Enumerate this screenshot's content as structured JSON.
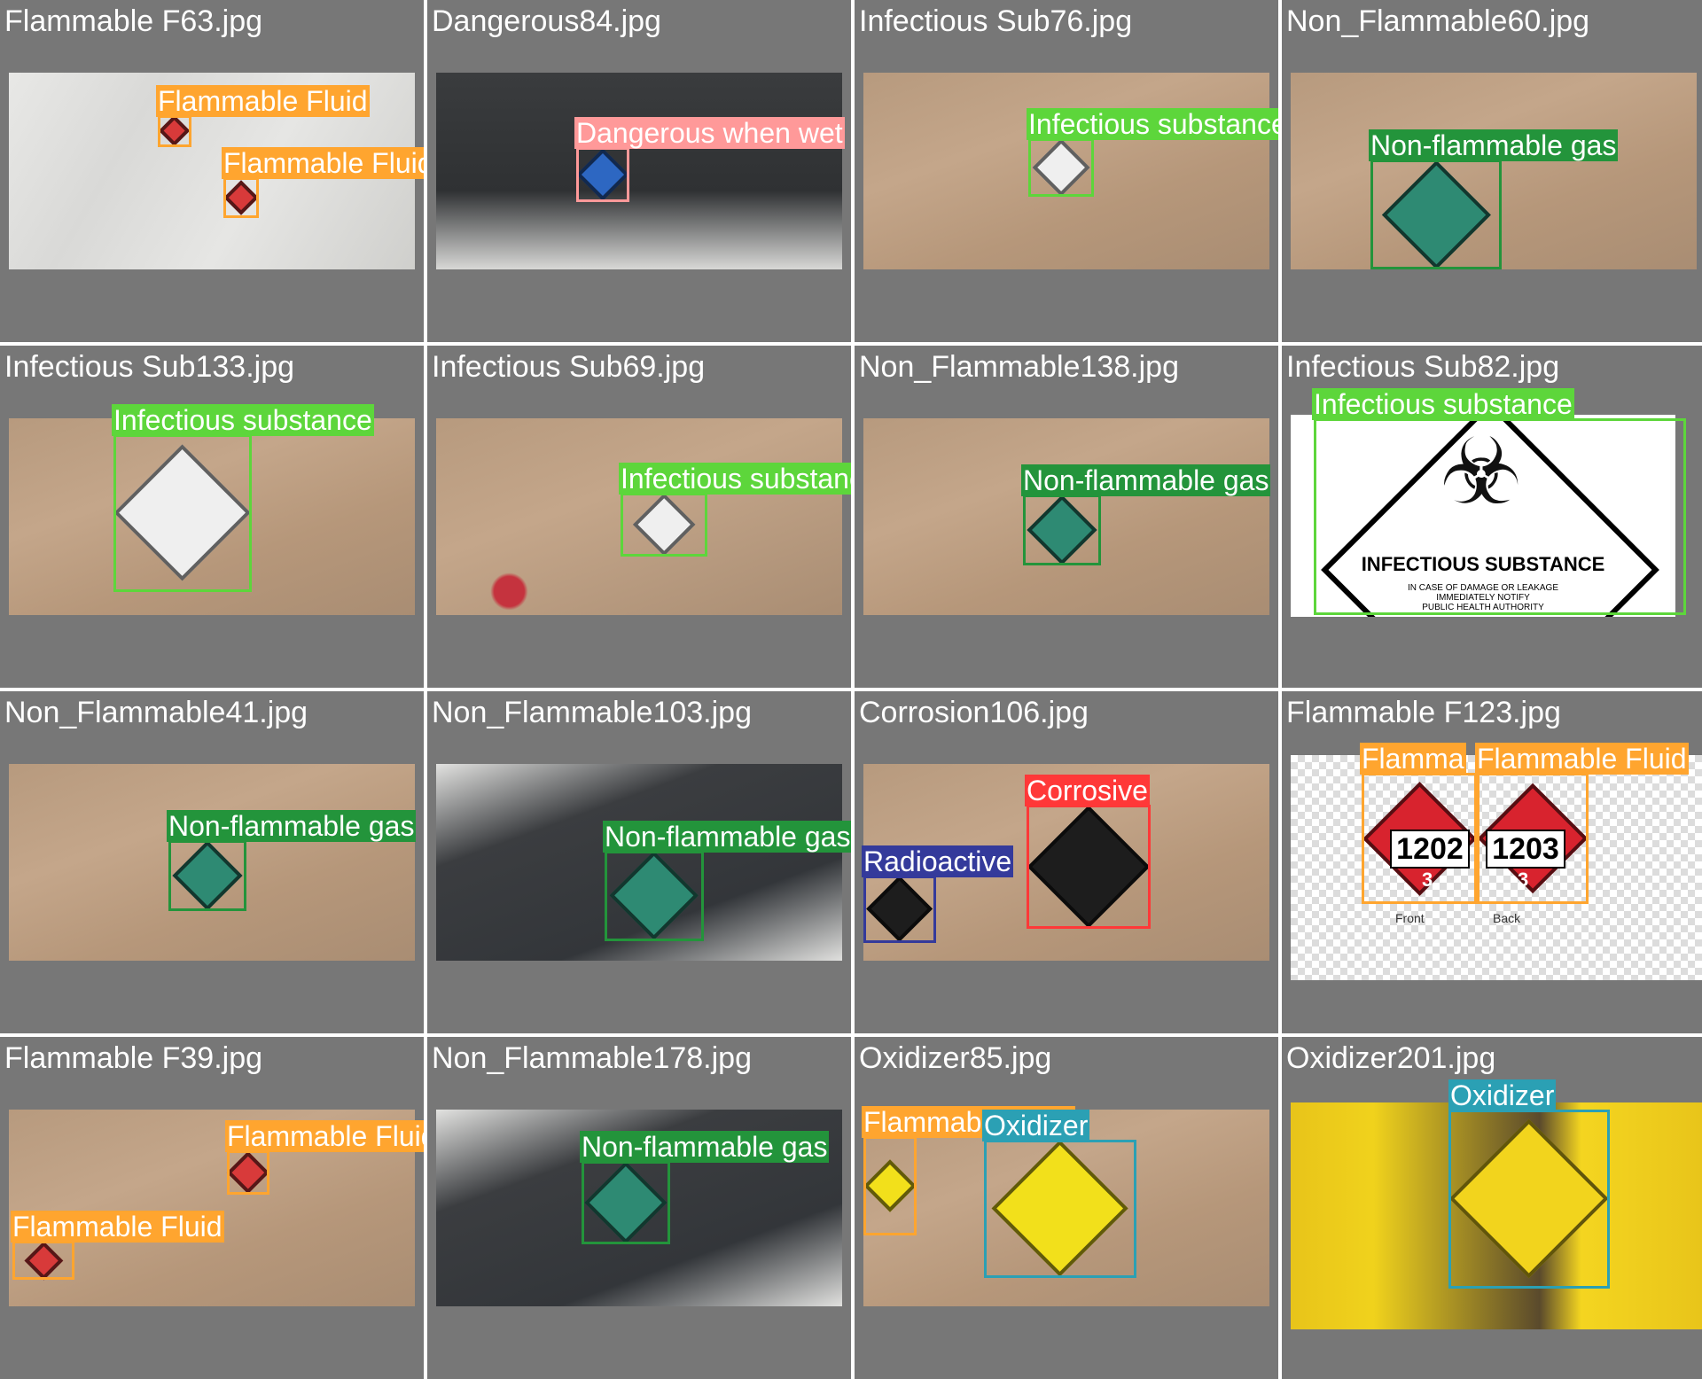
{
  "colors": {
    "flammable": "#ffa52f",
    "dangerous": "#ff9999",
    "infectious": "#5dd63b",
    "nonflammable": "#23943b",
    "corrosive": "#ff3838",
    "radioactive": "#343a9b",
    "oxidizer": "#2ba0b4"
  },
  "cells": [
    {
      "file": "Flammable F63.jpg",
      "photo": "wet-floor-cart",
      "boxes": [
        {
          "label": "Flammable Fluid",
          "color": "flammable"
        },
        {
          "label": "Flammable Fluid",
          "color": "flammable"
        }
      ]
    },
    {
      "file": "Dangerous84.jpg",
      "photo": "cart-with-shoes",
      "boxes": [
        {
          "label": "Dangerous when wet",
          "color": "dangerous"
        }
      ]
    },
    {
      "file": "Infectious Sub76.jpg",
      "photo": "cork-board",
      "boxes": [
        {
          "label": "Infectious substance",
          "color": "infectious"
        }
      ]
    },
    {
      "file": "Non_Flammable60.jpg",
      "photo": "cork-board",
      "boxes": [
        {
          "label": "Non-flammable gas",
          "color": "nonflammable"
        }
      ]
    },
    {
      "file": "Infectious Sub133.jpg",
      "photo": "cork-board",
      "boxes": [
        {
          "label": "Infectious substance",
          "color": "infectious"
        }
      ]
    },
    {
      "file": "Infectious Sub69.jpg",
      "photo": "cork-board-red-spot",
      "boxes": [
        {
          "label": "Infectious substance",
          "color": "infectious"
        }
      ]
    },
    {
      "file": "Non_Flammable138.jpg",
      "photo": "cork-board",
      "boxes": [
        {
          "label": "Non-flammable gas",
          "color": "nonflammable"
        }
      ]
    },
    {
      "file": "Infectious Sub82.jpg",
      "photo": "white-placard",
      "boxes": [
        {
          "label": "Infectious substance",
          "color": "infectious"
        }
      ],
      "placard": {
        "title": "INFECTIOUS SUBSTANCE",
        "lines": [
          "IN CASE OF DAMAGE OR LEAKAGE",
          "IMMEDIATELY NOTIFY",
          "PUBLIC HEALTH AUTHORITY"
        ]
      }
    },
    {
      "file": "Non_Flammable41.jpg",
      "photo": "cork-board",
      "boxes": [
        {
          "label": "Non-flammable gas",
          "color": "nonflammable"
        }
      ]
    },
    {
      "file": "Non_Flammable103.jpg",
      "photo": "cart-tiles",
      "boxes": [
        {
          "label": "Non-flammable gas",
          "color": "nonflammable"
        }
      ]
    },
    {
      "file": "Corrosion106.jpg",
      "photo": "cork-board",
      "boxes": [
        {
          "label": "Corrosive",
          "color": "corrosive"
        },
        {
          "label": "Radioactive",
          "color": "radioactive"
        }
      ]
    },
    {
      "file": "Flammable F123.jpg",
      "photo": "checker",
      "boxes": [
        {
          "label": "Flamma",
          "color": "flammable"
        },
        {
          "label": "Flammable Fluid",
          "color": "flammable"
        }
      ],
      "un_numbers": [
        "1202",
        "1203"
      ],
      "class_number": "3",
      "captions": [
        "Front",
        "Back"
      ]
    },
    {
      "file": "Flammable F39.jpg",
      "photo": "cork-board",
      "boxes": [
        {
          "label": "Flammable Fluid",
          "color": "flammable"
        },
        {
          "label": "Flammable Fluid",
          "color": "flammable"
        }
      ]
    },
    {
      "file": "Non_Flammable178.jpg",
      "photo": "cart-tiles",
      "boxes": [
        {
          "label": "Non-flammable gas",
          "color": "nonflammable"
        }
      ]
    },
    {
      "file": "Oxidizer85.jpg",
      "photo": "cork-board",
      "boxes": [
        {
          "label": "Flammable Fluid",
          "color": "flammable"
        },
        {
          "label": "Oxidizer",
          "color": "oxidizer"
        }
      ]
    },
    {
      "file": "Oxidizer201.jpg",
      "photo": "yellow-buckets",
      "boxes": [
        {
          "label": "Oxidizer",
          "color": "oxidizer"
        }
      ]
    }
  ]
}
